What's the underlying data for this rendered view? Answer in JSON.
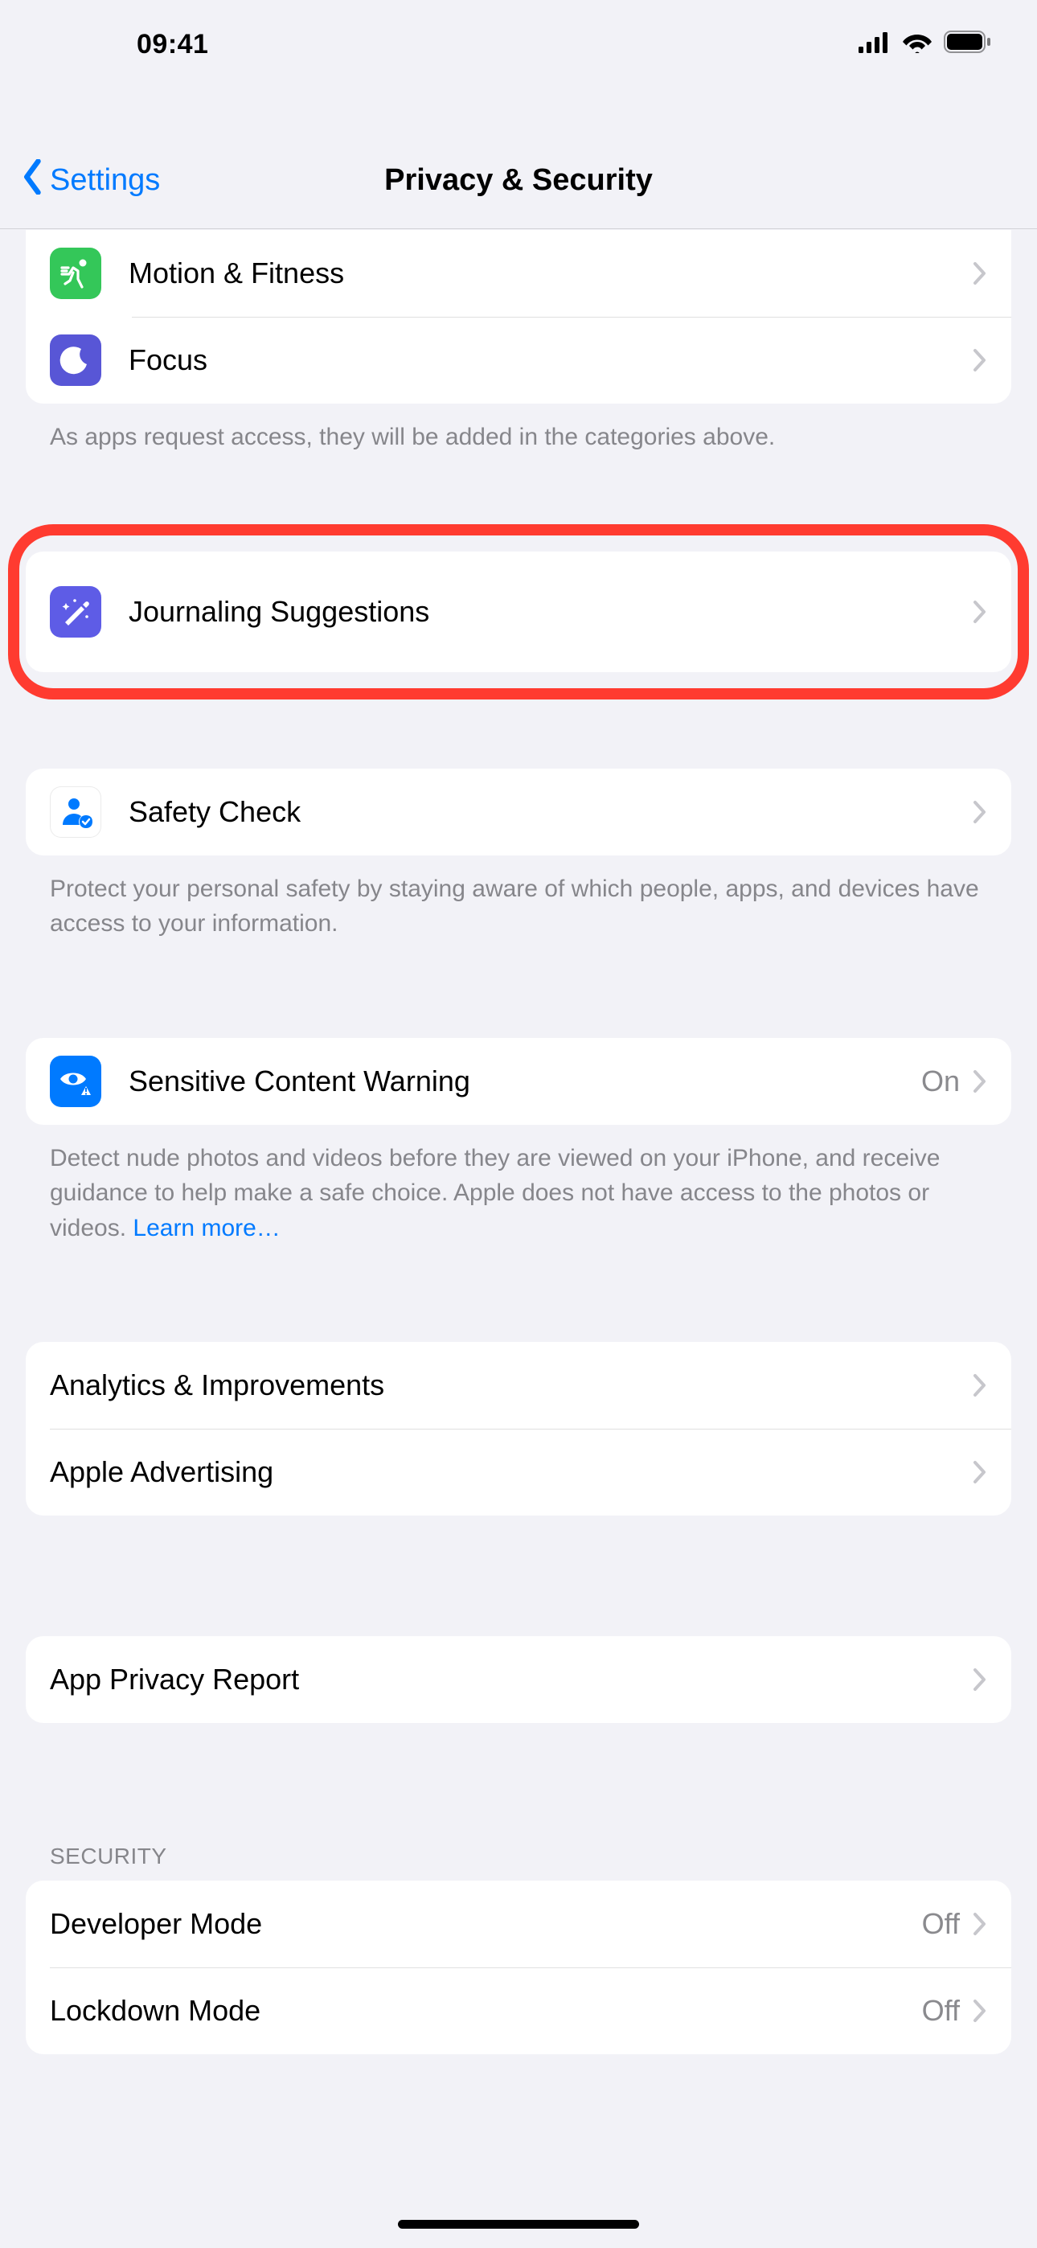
{
  "status": {
    "time": "09:41"
  },
  "nav": {
    "back": "Settings",
    "title": "Privacy & Security"
  },
  "rows": {
    "motion": {
      "label": "Motion & Fitness"
    },
    "focus": {
      "label": "Focus"
    },
    "journal": {
      "label": "Journaling Suggestions"
    },
    "safety": {
      "label": "Safety Check"
    },
    "scw": {
      "label": "Sensitive Content Warning",
      "value": "On"
    },
    "analytics": {
      "label": "Analytics & Improvements"
    },
    "ads": {
      "label": "Apple Advertising"
    },
    "report": {
      "label": "App Privacy Report"
    },
    "dev": {
      "label": "Developer Mode",
      "value": "Off"
    },
    "lockdown": {
      "label": "Lockdown Mode",
      "value": "Off"
    }
  },
  "footers": {
    "access": "As apps request access, they will be added in the categories above.",
    "safety": "Protect your personal safety by staying aware of which people, apps, and devices have access to your information.",
    "scw": "Detect nude photos and videos before they are viewed on your iPhone, and receive guidance to help make a safe choice. Apple does not have access to the photos or videos. ",
    "scw_link": "Learn more…"
  },
  "headers": {
    "security": "SECURITY"
  },
  "colors": {
    "motion": "#34c759",
    "focus": "#5856d6",
    "journal": "#5e5ce6",
    "scw": "#007aff",
    "safety_person": "#007aff"
  }
}
